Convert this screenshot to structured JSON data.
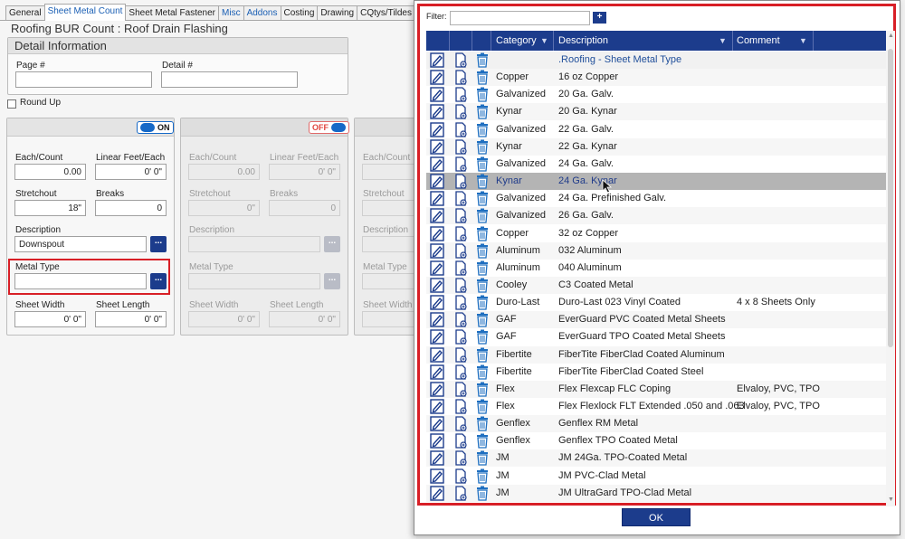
{
  "tabs": [
    {
      "label": "General"
    },
    {
      "label": "Sheet Metal Count"
    },
    {
      "label": "Sheet Metal Fastener"
    },
    {
      "label": "Misc"
    },
    {
      "label": "Addons"
    },
    {
      "label": "Costing"
    },
    {
      "label": "Drawing"
    },
    {
      "label": "CQtys/Tildes"
    }
  ],
  "page_title": "Roofing BUR Count : Roof Drain Flashing",
  "detail": {
    "header": "Detail Information",
    "page_label": "Page #",
    "page_value": "",
    "detail_label": "Detail #",
    "detail_value": ""
  },
  "round_up_label": "Round Up",
  "columns": [
    {
      "toggle": "ON",
      "each_count_label": "Each/Count",
      "each_count": "0.00",
      "linear_label": "Linear Feet/Each",
      "linear": "0' 0\"",
      "stretchout_label": "Stretchout",
      "stretchout": "18\"",
      "breaks_label": "Breaks",
      "breaks": "0",
      "description_label": "Description",
      "description": "Downspout",
      "metal_type_label": "Metal Type",
      "metal_type": "",
      "sheet_width_label": "Sheet Width",
      "sheet_width": "0' 0\"",
      "sheet_length_label": "Sheet Length",
      "sheet_length": "0' 0\""
    },
    {
      "toggle": "OFF",
      "each_count_label": "Each/Count",
      "each_count": "0.00",
      "linear_label": "Linear Feet/Each",
      "linear": "0' 0\"",
      "stretchout_label": "Stretchout",
      "stretchout": "0\"",
      "breaks_label": "Breaks",
      "breaks": "0",
      "description_label": "Description",
      "description": "",
      "metal_type_label": "Metal Type",
      "metal_type": "",
      "sheet_width_label": "Sheet Width",
      "sheet_width": "0' 0\"",
      "sheet_length_label": "Sheet Length",
      "sheet_length": "0' 0\""
    },
    {
      "each_count_label": "Each/Count",
      "stretchout_label": "Stretchout",
      "description_label": "Description",
      "metal_type_label": "Metal Type",
      "sheet_width_label": "Sheet Width"
    }
  ],
  "dots_label": "...",
  "dialog": {
    "filter_label": "Filter:",
    "filter_value": "",
    "add_label": "+",
    "headers": {
      "category": "Category",
      "description": "Description",
      "comment": "Comment"
    },
    "rows": [
      {
        "category": "",
        "description": ".Roofing - Sheet Metal Type",
        "comment": "",
        "group": true
      },
      {
        "category": "Copper",
        "description": "16 oz Copper",
        "comment": ""
      },
      {
        "category": "Galvanized",
        "description": "20 Ga. Galv.",
        "comment": ""
      },
      {
        "category": "Kynar",
        "description": "20 Ga. Kynar",
        "comment": ""
      },
      {
        "category": "Galvanized",
        "description": "22 Ga. Galv.",
        "comment": ""
      },
      {
        "category": "Kynar",
        "description": "22 Ga. Kynar",
        "comment": ""
      },
      {
        "category": "Galvanized",
        "description": "24 Ga. Galv.",
        "comment": ""
      },
      {
        "category": "Kynar",
        "description": "24 Ga. Kynar",
        "comment": "",
        "selected": true
      },
      {
        "category": "Galvanized",
        "description": "24 Ga. Prefinished Galv.",
        "comment": ""
      },
      {
        "category": "Galvanized",
        "description": "26 Ga. Galv.",
        "comment": ""
      },
      {
        "category": "Copper",
        "description": "32 oz Copper",
        "comment": ""
      },
      {
        "category": "Aluminum",
        "description": "032 Aluminum",
        "comment": ""
      },
      {
        "category": "Aluminum",
        "description": "040 Aluminum",
        "comment": ""
      },
      {
        "category": "Cooley",
        "description": "C3 Coated Metal",
        "comment": ""
      },
      {
        "category": "Duro-Last",
        "description": "Duro-Last 023 Vinyl Coated",
        "comment": "4 x 8 Sheets Only"
      },
      {
        "category": "GAF",
        "description": "EverGuard PVC Coated Metal Sheets",
        "comment": ""
      },
      {
        "category": "GAF",
        "description": "EverGuard TPO Coated Metal Sheets",
        "comment": ""
      },
      {
        "category": "Fibertite",
        "description": "FiberTite FiberClad Coated Aluminum",
        "comment": ""
      },
      {
        "category": "Fibertite",
        "description": "FiberTite FiberClad Coated Steel",
        "comment": ""
      },
      {
        "category": "Flex",
        "description": "Flex Flexcap FLC Coping",
        "comment": "Elvaloy, PVC, TPO"
      },
      {
        "category": "Flex",
        "description": "Flex Flexlock FLT Extended .050 and .063",
        "comment": "Elvaloy, PVC, TPO"
      },
      {
        "category": "Genflex",
        "description": "Genflex RM Metal",
        "comment": ""
      },
      {
        "category": "Genflex",
        "description": "Genflex TPO Coated Metal",
        "comment": ""
      },
      {
        "category": "JM",
        "description": "JM 24Ga. TPO-Coated Metal",
        "comment": ""
      },
      {
        "category": "JM",
        "description": "JM PVC-Clad Metal",
        "comment": ""
      },
      {
        "category": "JM",
        "description": "JM UltraGard TPO-Clad Metal",
        "comment": ""
      }
    ],
    "ok_label": "OK"
  },
  "icons": {
    "edit": "edit-icon",
    "copy": "copy-document-icon",
    "delete": "trash-icon",
    "filter": "filter-icon"
  },
  "colors": {
    "accent": "#1c3c8c",
    "highlight_border": "#d81f26",
    "selected_row": "#b4b4b4"
  }
}
